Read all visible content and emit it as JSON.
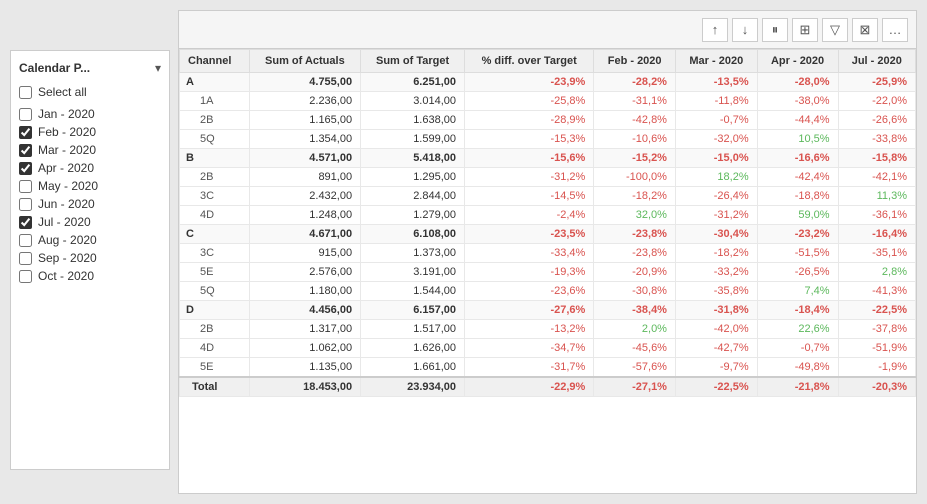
{
  "sidebar": {
    "title": "Calendar P...",
    "selectAll": {
      "label": "Select all",
      "checked": false
    },
    "items": [
      {
        "label": "Jan - 2020",
        "checked": false
      },
      {
        "label": "Feb - 2020",
        "checked": true
      },
      {
        "label": "Mar - 2020",
        "checked": true
      },
      {
        "label": "Apr - 2020",
        "checked": true
      },
      {
        "label": "May - 2020",
        "checked": false
      },
      {
        "label": "Jun - 2020",
        "checked": false
      },
      {
        "label": "Jul - 2020",
        "checked": true
      },
      {
        "label": "Aug - 2020",
        "checked": false
      },
      {
        "label": "Sep - 2020",
        "checked": false
      },
      {
        "label": "Oct - 2020",
        "checked": false
      }
    ]
  },
  "toolbar": {
    "buttons": [
      "↑",
      "↓",
      "⏸",
      "⊞",
      "▽",
      "⊠",
      "…"
    ]
  },
  "table": {
    "headers": [
      "Channel",
      "Sum of Actuals",
      "Sum of Target",
      "% diff. over Target",
      "Feb - 2020",
      "Mar - 2020",
      "Apr - 2020",
      "Jul - 2020"
    ],
    "rows": [
      {
        "type": "group",
        "cells": [
          "A",
          "4.755,00",
          "6.251,00",
          "-23,9%",
          "-28,2%",
          "-13,5%",
          "-28,0%",
          "-25,9%"
        ]
      },
      {
        "type": "sub",
        "cells": [
          "1A",
          "2.236,00",
          "3.014,00",
          "-25,8%",
          "-31,1%",
          "-11,8%",
          "-38,0%",
          "-22,0%"
        ]
      },
      {
        "type": "sub",
        "cells": [
          "2B",
          "1.165,00",
          "1.638,00",
          "-28,9%",
          "-42,8%",
          "-0,7%",
          "-44,4%",
          "-26,6%"
        ]
      },
      {
        "type": "sub",
        "cells": [
          "5Q",
          "1.354,00",
          "1.599,00",
          "-15,3%",
          "-10,6%",
          "-32,0%",
          "10,5%",
          "-33,8%"
        ]
      },
      {
        "type": "group",
        "cells": [
          "B",
          "4.571,00",
          "5.418,00",
          "-15,6%",
          "-15,2%",
          "-15,0%",
          "-16,6%",
          "-15,8%"
        ]
      },
      {
        "type": "sub",
        "cells": [
          "2B",
          "891,00",
          "1.295,00",
          "-31,2%",
          "-100,0%",
          "18,2%",
          "-42,4%",
          "-42,1%"
        ]
      },
      {
        "type": "sub",
        "cells": [
          "3C",
          "2.432,00",
          "2.844,00",
          "-14,5%",
          "-18,2%",
          "-26,4%",
          "-18,8%",
          "11,3%"
        ]
      },
      {
        "type": "sub",
        "cells": [
          "4D",
          "1.248,00",
          "1.279,00",
          "-2,4%",
          "32,0%",
          "-31,2%",
          "59,0%",
          "-36,1%"
        ]
      },
      {
        "type": "group",
        "cells": [
          "C",
          "4.671,00",
          "6.108,00",
          "-23,5%",
          "-23,8%",
          "-30,4%",
          "-23,2%",
          "-16,4%"
        ]
      },
      {
        "type": "sub",
        "cells": [
          "3C",
          "915,00",
          "1.373,00",
          "-33,4%",
          "-23,8%",
          "-18,2%",
          "-51,5%",
          "-35,1%"
        ]
      },
      {
        "type": "sub",
        "cells": [
          "5E",
          "2.576,00",
          "3.191,00",
          "-19,3%",
          "-20,9%",
          "-33,2%",
          "-26,5%",
          "2,8%"
        ]
      },
      {
        "type": "sub",
        "cells": [
          "5Q",
          "1.180,00",
          "1.544,00",
          "-23,6%",
          "-30,8%",
          "-35,8%",
          "7,4%",
          "-41,3%"
        ]
      },
      {
        "type": "group",
        "cells": [
          "D",
          "4.456,00",
          "6.157,00",
          "-27,6%",
          "-38,4%",
          "-31,8%",
          "-18,4%",
          "-22,5%"
        ]
      },
      {
        "type": "sub",
        "cells": [
          "2B",
          "1.317,00",
          "1.517,00",
          "-13,2%",
          "2,0%",
          "-42,0%",
          "22,6%",
          "-37,8%"
        ]
      },
      {
        "type": "sub",
        "cells": [
          "4D",
          "1.062,00",
          "1.626,00",
          "-34,7%",
          "-45,6%",
          "-42,7%",
          "-0,7%",
          "-51,9%"
        ]
      },
      {
        "type": "sub",
        "cells": [
          "5E",
          "1.135,00",
          "1.661,00",
          "-31,7%",
          "-57,6%",
          "-9,7%",
          "-49,8%",
          "-1,9%"
        ]
      },
      {
        "type": "total",
        "cells": [
          "Total",
          "18.453,00",
          "23.934,00",
          "-22,9%",
          "-27,1%",
          "-22,5%",
          "-21,8%",
          "-20,3%"
        ]
      }
    ],
    "colorRules": {
      "redCols": [
        3,
        4,
        5,
        6,
        7
      ],
      "posGreen": true
    }
  }
}
